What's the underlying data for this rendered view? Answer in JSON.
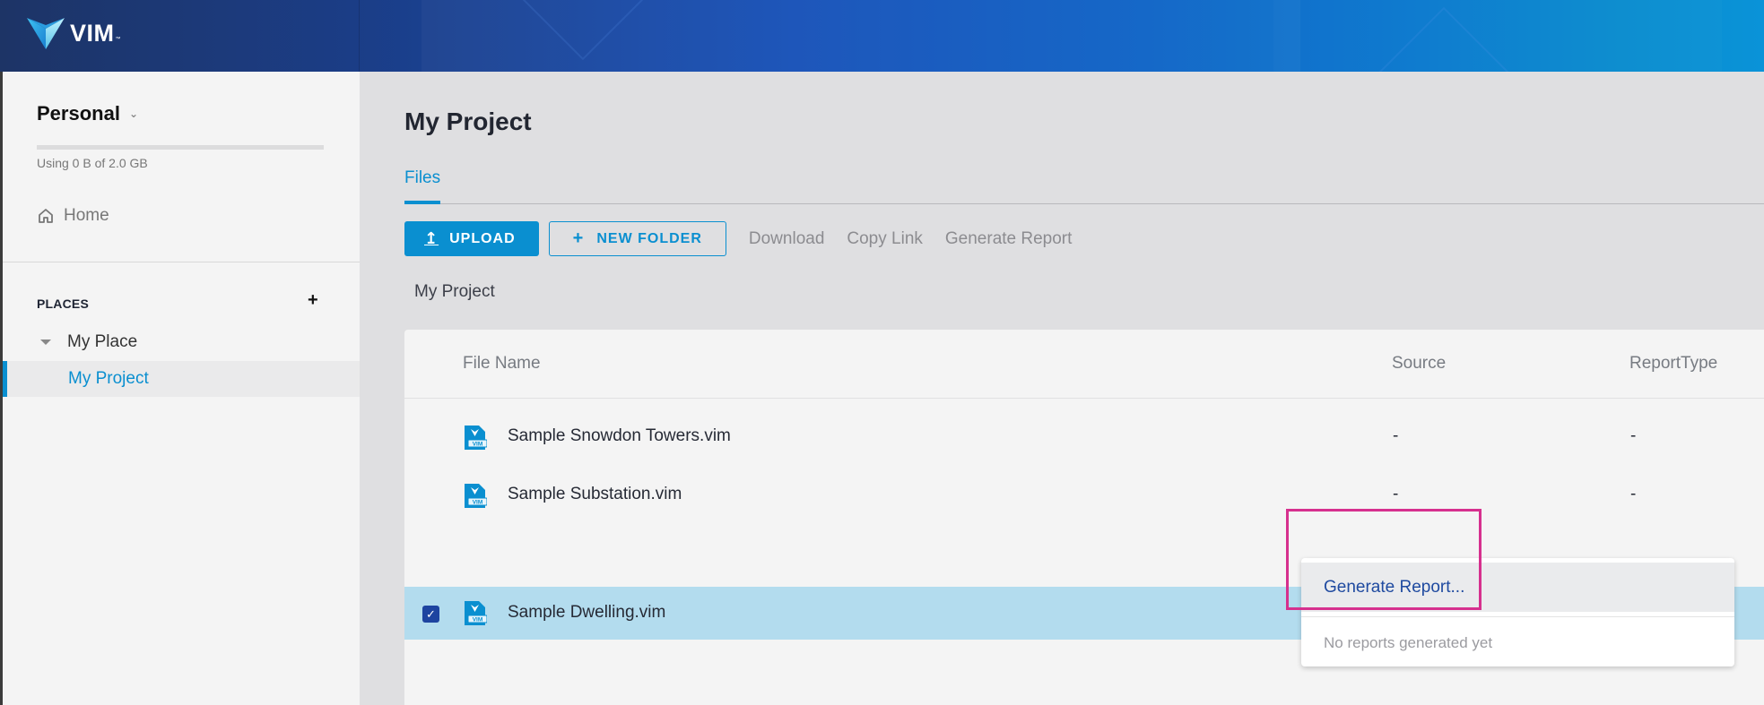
{
  "app": {
    "logo_text": "VIM",
    "logo_tm": "™"
  },
  "sidebar": {
    "workspace_title": "Personal",
    "storage_used_fraction": 0,
    "storage_text": "Using 0 B of 2.0 GB",
    "home_label": "Home",
    "places_label": "PLACES",
    "places_add": "+",
    "tree": {
      "place_label": "My Place",
      "project_label": "My Project"
    }
  },
  "main": {
    "title": "My Project",
    "tabs": [
      {
        "label": "Files",
        "active": true
      }
    ],
    "toolbar": {
      "upload_label": "UPLOAD",
      "upload_icon": "↥",
      "new_folder_label": "NEW FOLDER",
      "new_folder_icon": "+",
      "download_label": "Download",
      "copy_link_label": "Copy Link",
      "generate_report_label": "Generate Report"
    },
    "breadcrumb": "My Project",
    "table": {
      "columns": [
        "File Name",
        "Source",
        "ReportType"
      ],
      "rows": [
        {
          "name": "Sample Snowdon Towers.vim",
          "source": "-",
          "report_type": "-",
          "selected": false
        },
        {
          "name": "Sample Substation.vim",
          "source": "-",
          "report_type": "-",
          "selected": false
        },
        {
          "name": "Sample Dwelling.vim",
          "source": "-",
          "report_type": "-",
          "selected": true
        }
      ],
      "file_icon_label": "VIM",
      "checkbox_glyph": "✓"
    },
    "report_menu": {
      "generate_label": "Generate Report...",
      "empty_text": "No reports generated yet"
    }
  },
  "colors": {
    "accent": "#0a8fd0",
    "selected_row": "#b3dcee",
    "highlight": "#d6308e",
    "menu_link": "#1f4aa0"
  }
}
